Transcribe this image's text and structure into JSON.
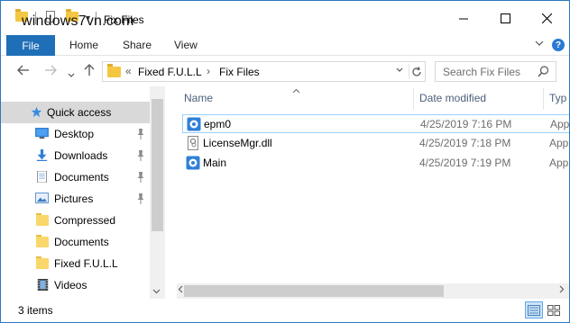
{
  "watermark": "windows7vn.com",
  "window": {
    "title": "Fix Files",
    "minimize_icon": "minimize-icon",
    "maximize_icon": "maximize-icon",
    "close_icon": "close-icon"
  },
  "ribbon": {
    "tabs": [
      "File",
      "Home",
      "Share",
      "View"
    ]
  },
  "navigation": {
    "breadcrumb_overflow": "«",
    "breadcrumb": [
      "Fixed F.U.L.L",
      "Fix Files"
    ],
    "search_placeholder": "Search Fix Files"
  },
  "sidebar": {
    "items": [
      {
        "label": "Quick access",
        "icon": "star-icon",
        "pinned": false,
        "selected": true
      },
      {
        "label": "Desktop",
        "icon": "desktop-icon",
        "pinned": true
      },
      {
        "label": "Downloads",
        "icon": "download-icon",
        "pinned": true
      },
      {
        "label": "Documents",
        "icon": "documents-icon",
        "pinned": true
      },
      {
        "label": "Pictures",
        "icon": "pictures-icon",
        "pinned": true
      },
      {
        "label": "Compressed",
        "icon": "folder-icon",
        "pinned": false
      },
      {
        "label": "Documents",
        "icon": "folder-icon",
        "pinned": false
      },
      {
        "label": "Fixed F.U.L.L",
        "icon": "folder-icon",
        "pinned": false
      },
      {
        "label": "Videos",
        "icon": "videos-icon",
        "pinned": false
      }
    ]
  },
  "file_list": {
    "columns": [
      "Name",
      "Date modified",
      "Typ"
    ],
    "rows": [
      {
        "name": "epm0",
        "date": "4/25/2019 7:16 PM",
        "type": "App",
        "icon": "app-icon"
      },
      {
        "name": "LicenseMgr.dll",
        "date": "4/25/2019 7:18 PM",
        "type": "App",
        "icon": "dll-icon"
      },
      {
        "name": "Main",
        "date": "4/25/2019 7:19 PM",
        "type": "App",
        "icon": "app-icon"
      }
    ]
  },
  "status": {
    "item_count": "3 items"
  },
  "colors": {
    "accent": "#1f6fb8",
    "folder": "#f4c742",
    "selection": "#d9d9d9"
  }
}
